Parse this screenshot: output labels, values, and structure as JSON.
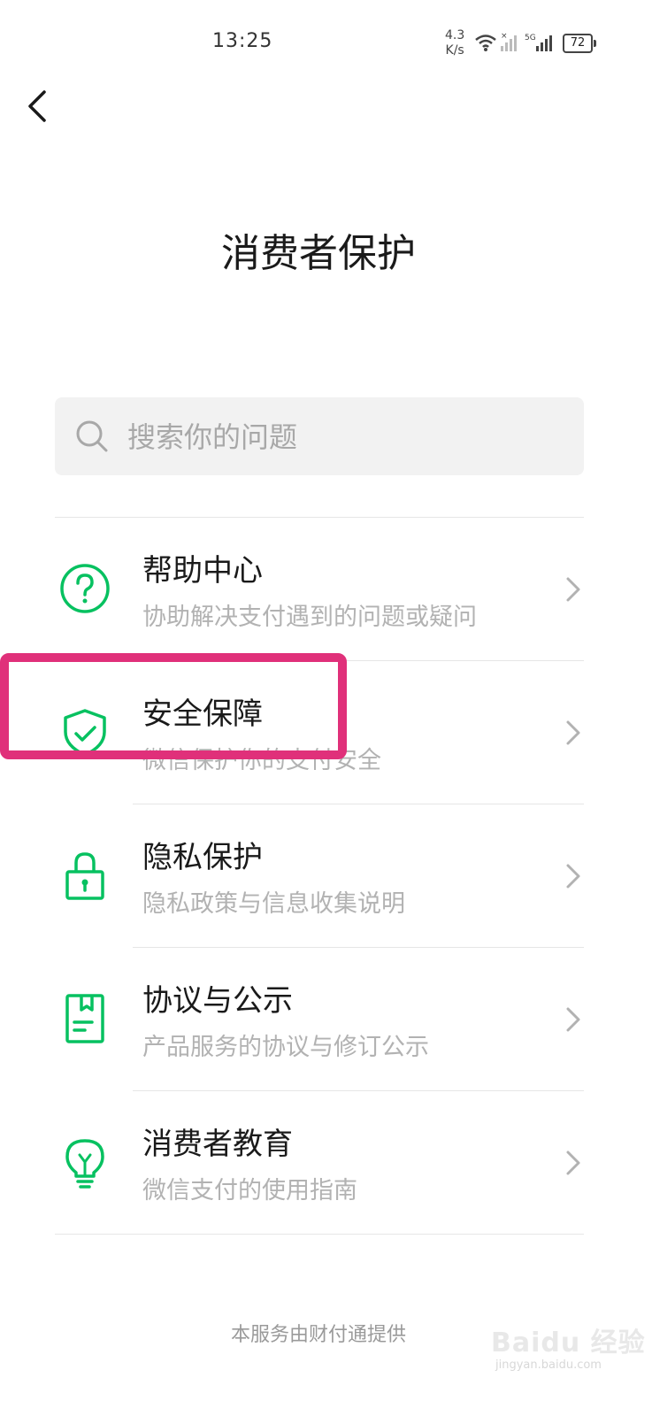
{
  "status_bar": {
    "time": "13:25",
    "net_speed_value": "4.3",
    "net_speed_unit": "K/s",
    "network_type": "5G",
    "battery_level": "72"
  },
  "header": {
    "title": "消费者保护"
  },
  "search": {
    "placeholder": "搜索你的问题"
  },
  "menu": {
    "items": [
      {
        "title": "帮助中心",
        "subtitle": "协助解决支付遇到的问题或疑问",
        "icon": "question-circle-icon"
      },
      {
        "title": "安全保障",
        "subtitle": "微信保护你的支付安全",
        "icon": "shield-check-icon"
      },
      {
        "title": "隐私保护",
        "subtitle": "隐私政策与信息收集说明",
        "icon": "lock-icon"
      },
      {
        "title": "协议与公示",
        "subtitle": "产品服务的协议与修订公示",
        "icon": "document-icon"
      },
      {
        "title": "消费者教育",
        "subtitle": "微信支付的使用指南",
        "icon": "lightbulb-icon"
      }
    ]
  },
  "footer": {
    "provider_text": "本服务由财付通提供"
  },
  "watermark": {
    "text": "Baidu 经验",
    "url": "jingyan.baidu.com"
  },
  "colors": {
    "accent_green": "#07c160",
    "highlight": "#e0307a"
  }
}
